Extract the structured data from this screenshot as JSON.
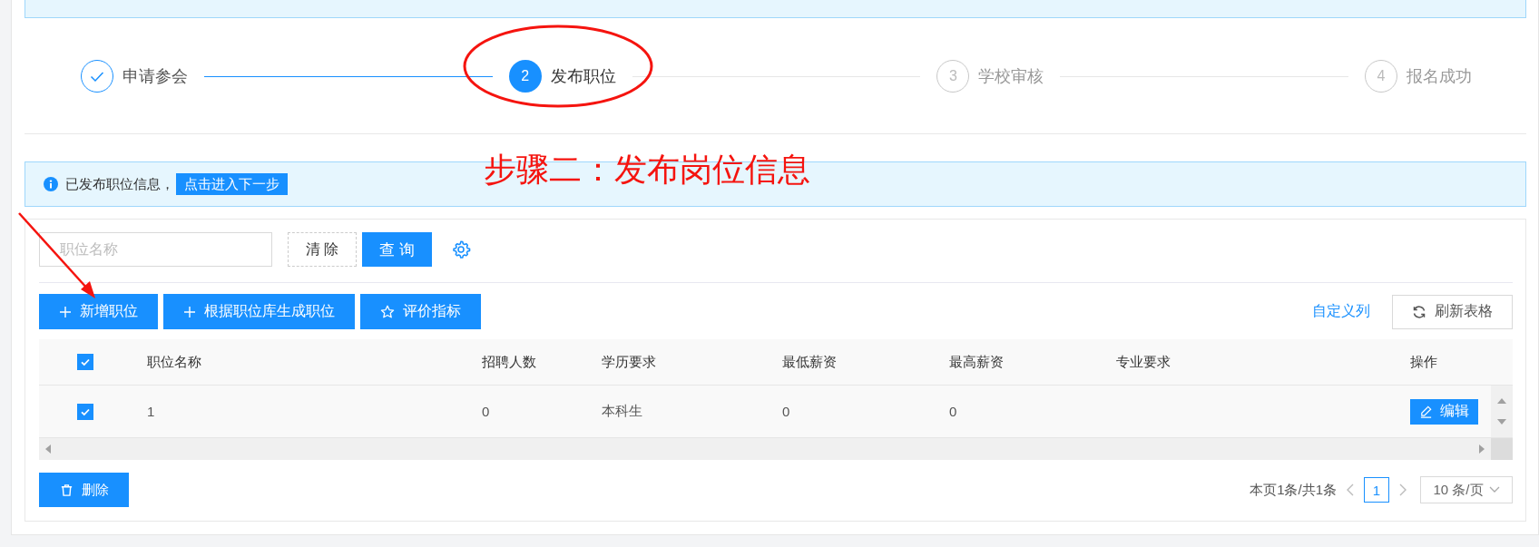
{
  "steps": [
    {
      "label": "申请参会",
      "finished": true,
      "selected": false
    },
    {
      "number": "2",
      "label": "发布职位",
      "finished": false,
      "selected": true
    },
    {
      "number": "3",
      "label": "学校审核",
      "finished": false,
      "selected": false
    },
    {
      "number": "4",
      "label": "报名成功",
      "finished": false,
      "selected": false
    }
  ],
  "annotation": {
    "text": "步骤二：发布岗位信息"
  },
  "alert": {
    "text": "已发布职位信息，",
    "action": "点击进入下一步"
  },
  "search": {
    "placeholder": "职位名称",
    "clear": "清 除",
    "query": "查 询"
  },
  "toolbar": {
    "buttons": [
      {
        "label": "新增职位",
        "kind": "add"
      },
      {
        "label": "根据职位库生成职位",
        "kind": "add"
      },
      {
        "label": "评价指标",
        "kind": "star"
      }
    ],
    "custom_columns": "自定义列",
    "refresh": "刷新表格"
  },
  "table": {
    "select_all": {
      "checked": true
    },
    "columns": [
      "职位名称",
      "招聘人数",
      "学历要求",
      "最低薪资",
      "最高薪资",
      "专业要求",
      "操作"
    ],
    "rows": [
      {
        "checked": true,
        "cells": [
          "1",
          "0",
          "本科生",
          "0",
          "0",
          ""
        ],
        "action": "编辑"
      }
    ]
  },
  "delete": "删除",
  "pagination": {
    "summary": "本页1条/共1条",
    "pages": [
      {
        "label": "1",
        "selected": true
      }
    ],
    "page_size": "10 条/页"
  }
}
